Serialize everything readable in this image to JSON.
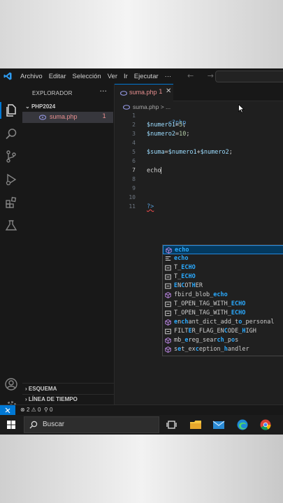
{
  "window": {
    "menu": [
      "Archivo",
      "Editar",
      "Selección",
      "Ver",
      "Ir",
      "Ejecutar",
      "···"
    ],
    "nav_arrows": "← →"
  },
  "sidebar": {
    "header": "EXPLORADOR",
    "more": "···",
    "folder": "PHP2024",
    "file": {
      "name": "suma.php",
      "problems": "1"
    },
    "sections": [
      "ESQUEMA",
      "LÍNEA DE TIEMPO"
    ]
  },
  "editor": {
    "tab": {
      "name": "suma.php",
      "problems": "1",
      "close": "✕"
    },
    "breadcrumb": "suma.php > ...",
    "lines": [
      "1",
      "2",
      "3",
      "4",
      "5",
      "6",
      "7",
      "8",
      "9",
      "10",
      "11"
    ],
    "code": {
      "l1": "<?php",
      "l2a": "$numero1",
      "l2b": "=",
      "l2c": "5",
      "l2d": ";",
      "l3a": "$numero2",
      "l3b": "=",
      "l3c": "10",
      "l3d": ";",
      "l5a": "$suma",
      "l5b": "=",
      "l5c": "$numero1",
      "l5d": "+",
      "l5e": "$numero2",
      "l5f": ";",
      "l7": "echo",
      "l11": "?>"
    }
  },
  "suggestions": [
    {
      "label": "echo",
      "kind": "method-icon"
    },
    {
      "label": "echo",
      "kind": "snippet-icon"
    },
    {
      "label": "T_ECHO",
      "kind": "constant-icon"
    },
    {
      "label": "T_ECHO",
      "kind": "constant-icon"
    },
    {
      "label": "ENCOTHER",
      "kind": "constant-icon"
    },
    {
      "label": "fbird_blob_echo",
      "kind": "method-icon"
    },
    {
      "label": "T_OPEN_TAG_WITH_ECHO",
      "kind": "constant-icon"
    },
    {
      "label": "T_OPEN_TAG_WITH_ECHO",
      "kind": "constant-icon"
    },
    {
      "label": "enchant_dict_add_to_personal",
      "kind": "method-icon"
    },
    {
      "label": "FILTER_FLAG_ENCODE_HIGH",
      "kind": "constant-icon"
    },
    {
      "label": "mb_ereg_search_pos",
      "kind": "method-icon"
    },
    {
      "label": "set_exception_handler",
      "kind": "method-icon"
    }
  ],
  "status": {
    "errors": "2",
    "warnings": "0",
    "ports": "0"
  },
  "taskbar": {
    "search_placeholder": "Buscar"
  },
  "colors": {
    "accent": "#0078d4",
    "error_file": "#e88f8f",
    "match": "#2aaaff"
  }
}
